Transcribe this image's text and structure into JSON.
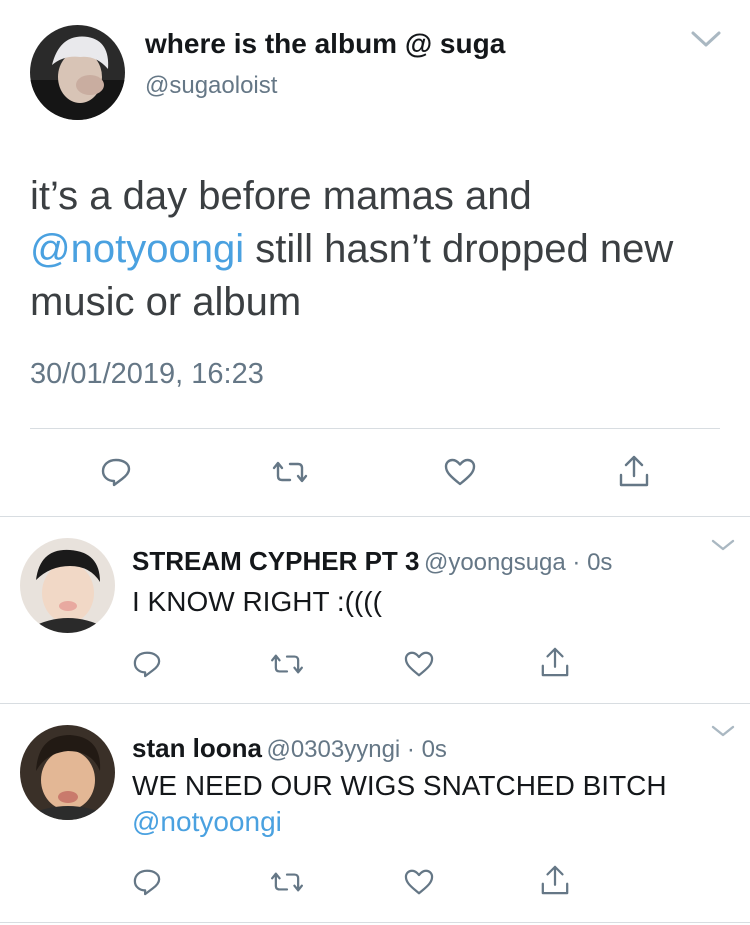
{
  "main_tweet": {
    "display_name": "where is the album @ suga",
    "handle": "@sugaoloist",
    "text_before": "it’s a day before mamas and ",
    "mention": "@notyoongi",
    "text_after": " still hasn’t dropped new music or album",
    "timestamp": "30/01/2019, 16:23",
    "actions": [
      "reply-icon",
      "retweet-icon",
      "like-icon",
      "share-icon"
    ]
  },
  "replies": [
    {
      "display_name": "STREAM CYPHER PT 3",
      "handle": "@yoongsuga",
      "separator": " · ",
      "time": "0s",
      "text": "I KNOW RIGHT :((((",
      "actions": [
        "reply-icon",
        "retweet-icon",
        "like-icon",
        "share-icon"
      ]
    },
    {
      "display_name": "stan loona",
      "handle": "@0303yyngi",
      "separator": " · ",
      "time": "0s",
      "text": "WE NEED OUR WIGS SNATCHED BITCH",
      "mention": "@notyoongi",
      "actions": [
        "reply-icon",
        "retweet-icon",
        "like-icon",
        "share-icon"
      ]
    }
  ],
  "colors": {
    "link": "#4aa1e0",
    "secondary_text": "#657786",
    "icon": "#657786",
    "divider": "#d8dde1"
  }
}
